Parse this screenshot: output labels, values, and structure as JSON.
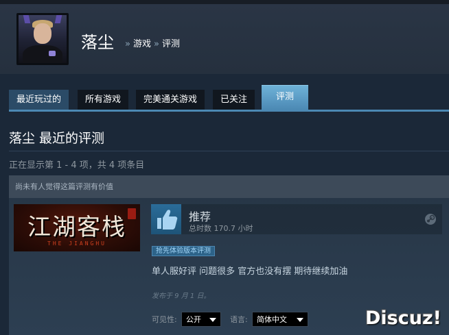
{
  "profile": {
    "name": "落尘"
  },
  "breadcrumb": {
    "sep1": "»",
    "games": "游戏",
    "sep2": "»",
    "reviews": "评测"
  },
  "tabs": [
    {
      "label": "最近玩过的"
    },
    {
      "label": "所有游戏"
    },
    {
      "label": "完美通关游戏"
    },
    {
      "label": "已关注"
    },
    {
      "label": "评测"
    }
  ],
  "section": {
    "title": "落尘 最近的评测",
    "showing": "正在显示第 1 - 4 项，共 4 项条目"
  },
  "review": {
    "helpful": "尚未有人觉得这篇评测有价值",
    "game_logo": "江湖客栈",
    "game_logo_en": "THE JIANGHU",
    "recommendation": "推荐",
    "hours": "总时数 170.7 小时",
    "early_access_badge": "抢先体验版本评测",
    "text": "单人服好评 问题很多 官方也没有摆 期待继续加油",
    "posted": "发布于 9 月 1 日。",
    "visibility_label": "可见性:",
    "visibility_value": "公开",
    "language_label": "语言:",
    "language_value": "简体中文"
  },
  "watermark": "Discuz!",
  "colors": {
    "background": "#1b2838",
    "accent": "#4c89b4",
    "text": "#c6d4df"
  }
}
